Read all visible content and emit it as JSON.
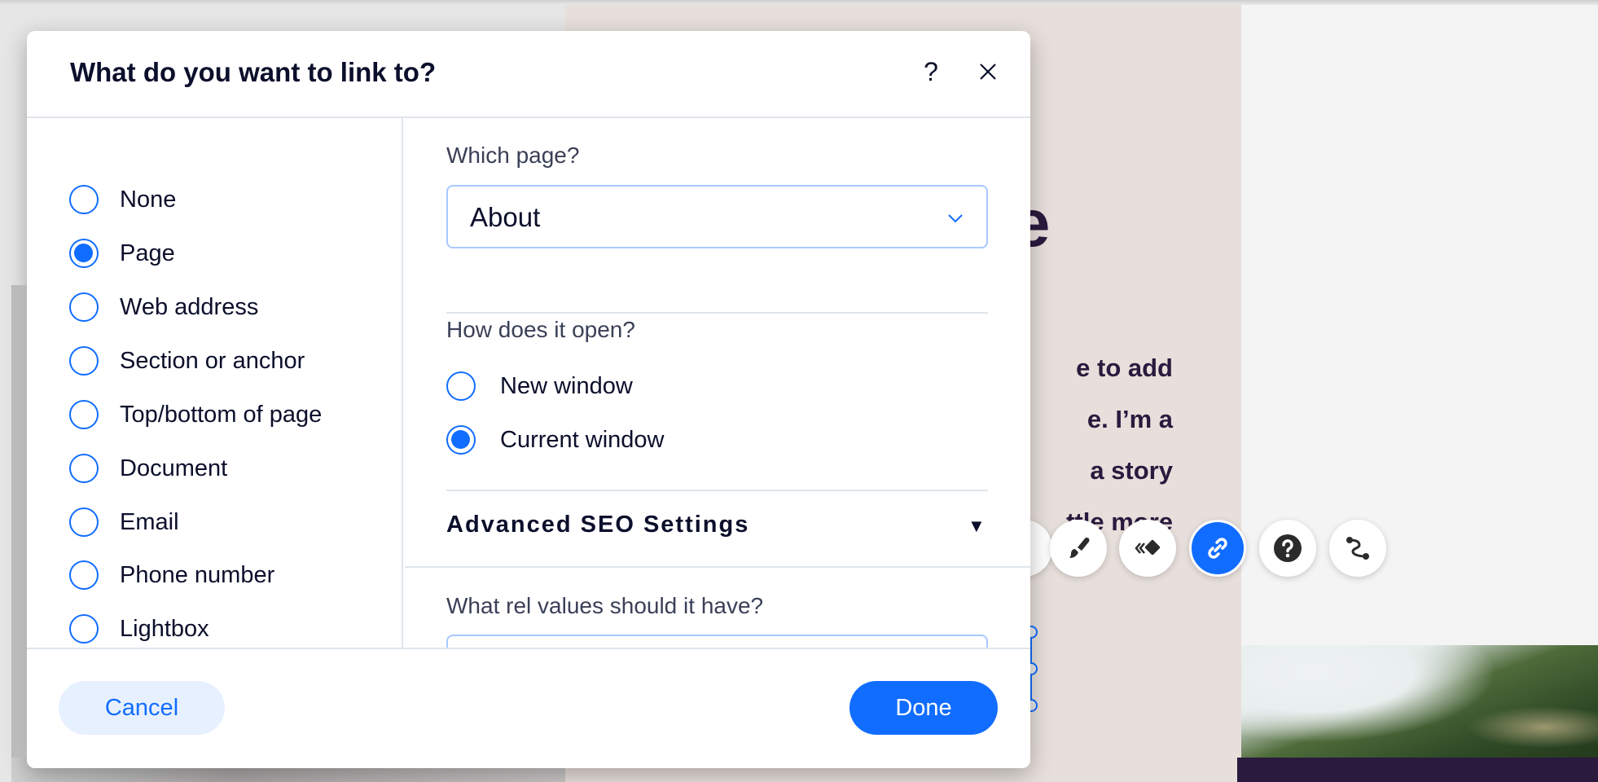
{
  "background": {
    "heading_fragment": "ade",
    "body_lines": [
      "e to add",
      "e. I’m a",
      "a story",
      "ttle more"
    ],
    "colors": {
      "section_bg": "#e7dfdb",
      "text": "#2a1a3e",
      "selection": "#116dff"
    }
  },
  "floating_toolbar": {
    "buttons": [
      {
        "icon": "paintbrush-icon",
        "label": "Design",
        "active": false
      },
      {
        "icon": "animation-icon",
        "label": "Animation",
        "active": false
      },
      {
        "icon": "link-icon",
        "label": "Link",
        "active": true
      },
      {
        "icon": "help-icon",
        "label": "Help",
        "active": false
      },
      {
        "icon": "connect-icon",
        "label": "Connect",
        "active": false
      }
    ]
  },
  "dialog": {
    "title": "What do you want to link to?",
    "help_label": "?",
    "link_types": [
      {
        "label": "None",
        "checked": false
      },
      {
        "label": "Page",
        "checked": true
      },
      {
        "label": "Web address",
        "checked": false
      },
      {
        "label": "Section or anchor",
        "checked": false
      },
      {
        "label": "Top/bottom of page",
        "checked": false
      },
      {
        "label": "Document",
        "checked": false
      },
      {
        "label": "Email",
        "checked": false
      },
      {
        "label": "Phone number",
        "checked": false
      },
      {
        "label": "Lightbox",
        "checked": false
      }
    ],
    "page_field": {
      "label": "Which page?",
      "selected": "About"
    },
    "open_field": {
      "label": "How does it open?",
      "options": [
        {
          "label": "New window",
          "checked": false
        },
        {
          "label": "Current window",
          "checked": true
        }
      ]
    },
    "seo": {
      "label": "Advanced SEO Settings",
      "caret": "▼"
    },
    "rel_field": {
      "label": "What rel values should it have?",
      "value": ""
    },
    "cancel_label": "Cancel",
    "done_label": "Done",
    "colors": {
      "accent": "#116dff",
      "accent_light": "#e7f0ff",
      "title": "#0b0f2b"
    }
  }
}
